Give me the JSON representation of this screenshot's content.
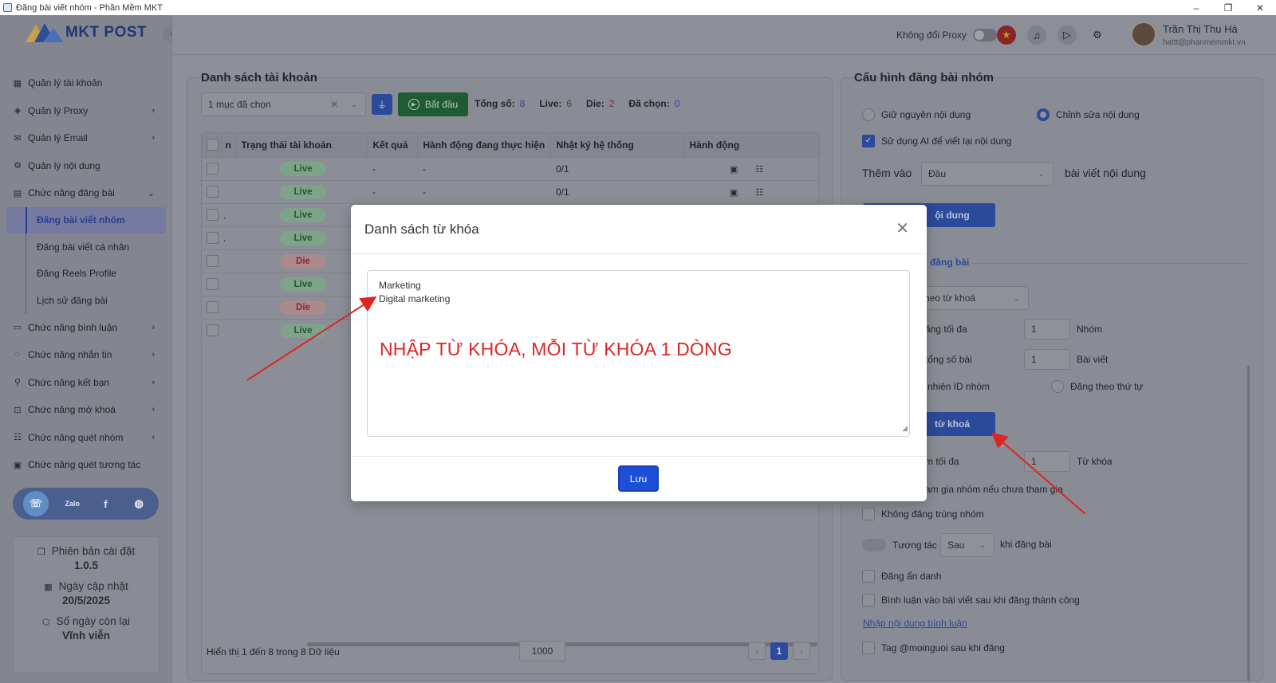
{
  "window": {
    "title": "Đăng bài viết nhóm - Phần Mềm MKT",
    "min": "–",
    "restore": "❐",
    "close": "✕"
  },
  "logo": {
    "text": "MKT POST"
  },
  "sidebar": {
    "items": [
      {
        "label": "Quản lý tài khoản",
        "icon": "grid-icon",
        "chev": ""
      },
      {
        "label": "Quản lý Proxy",
        "icon": "layers-icon",
        "chev": "›"
      },
      {
        "label": "Quản lý Email",
        "icon": "mail-icon",
        "chev": "›"
      },
      {
        "label": "Quản lý nội dung",
        "icon": "content-icon",
        "chev": ""
      },
      {
        "label": "Chức năng đăng bài",
        "icon": "post-icon",
        "chev": "⌄"
      }
    ],
    "subitems": [
      "Đăng bài viết nhóm",
      "Đăng bài viết cá nhân",
      "Đăng Reels Profile",
      "Lịch sử đăng bài"
    ],
    "items2": [
      {
        "label": "Chức năng bình luận",
        "chev": "›"
      },
      {
        "label": "Chức năng nhắn tin",
        "chev": "›"
      },
      {
        "label": "Chức năng kết bạn",
        "chev": "›"
      },
      {
        "label": "Chức năng mở khoá",
        "chev": "›"
      },
      {
        "label": "Chức năng quét nhóm",
        "chev": "›"
      },
      {
        "label": "Chức năng quét tương tác",
        "chev": ""
      }
    ],
    "info": [
      {
        "label": "Phiên bản cài đặt",
        "value": "1.0.5"
      },
      {
        "label": "Ngày cập nhật",
        "value": "20/5/2025"
      },
      {
        "label": "Số ngày còn lại",
        "value": "Vĩnh viễn"
      }
    ]
  },
  "topbar": {
    "proxy_label": "Không đổi Proxy",
    "user_name": "Trần Thị Thu Hà",
    "user_email": "hattt@phanmemmkt.vn"
  },
  "accounts": {
    "title": "Danh sách tài khoản",
    "select_value": "1 mục đã chọn",
    "start_label": "Bắt đầu",
    "stats": {
      "total_label": "Tổng số:",
      "total": "8",
      "live_label": "Live:",
      "live": "6",
      "die_label": "Die:",
      "die": "2",
      "selected_label": "Đã chọn:",
      "selected": "0"
    },
    "columns": [
      "n",
      "Trạng thái tài khoản",
      "Kết quả",
      "Hành động đang thực hiện",
      "Nhật ký hệ thống",
      "Hành động"
    ],
    "rows": [
      {
        "status": "Live",
        "result": "-",
        "action": "-",
        "log": "0/1",
        "n": ""
      },
      {
        "status": "Live",
        "result": "-",
        "action": "-",
        "log": "0/1",
        "n": ""
      },
      {
        "status": "Live",
        "result": "",
        "action": "",
        "log": "",
        "n": "."
      },
      {
        "status": "Live",
        "result": "",
        "action": "",
        "log": "",
        "n": "."
      },
      {
        "status": "Die",
        "result": "",
        "action": "",
        "log": "",
        "n": ""
      },
      {
        "status": "Live",
        "result": "",
        "action": "",
        "log": "",
        "n": ""
      },
      {
        "status": "Die",
        "result": "",
        "action": "",
        "log": "",
        "n": ""
      },
      {
        "status": "Live",
        "result": "",
        "action": "",
        "log": "",
        "n": ""
      }
    ],
    "footer": {
      "info": "Hiển thị 1 đến 8 trong 8 Dữ liệu",
      "page_size": "1000",
      "page": "1",
      "prev": "‹",
      "next": "›"
    }
  },
  "config": {
    "title": "Cấu hình đăng bài nhóm",
    "keep_content": "Giữ nguyên nội dung",
    "edit_content": "Chỉnh sửa nội dung",
    "use_ai": "Sử dụng AI để viết lại nội dung",
    "add_to_label": "Thêm vào",
    "add_to_value": "Đầu",
    "add_to_suffix": "bài viết nội dung",
    "content_btn": "ội dung",
    "section_label": "đăng bài",
    "mode_value": "heo từ khoá",
    "max_groups_label": "ăng tối đa",
    "max_groups": "1",
    "max_groups_unit": "Nhóm",
    "total_posts_label": "tổng số bài",
    "total_posts": "1",
    "total_posts_unit": "Bài viết",
    "random_id_label": "nhiên ID nhóm",
    "order_label": "Đăng theo thứ tự",
    "keyword_btn": "từ khoá",
    "max_keywords_label": "m tối đa",
    "max_keywords": "1",
    "max_keywords_unit": "Từ khóa",
    "join_label": "am gia nhóm nếu chưa tham gia",
    "no_dup": "Không đăng trùng nhóm",
    "interact_label": "Tương tác",
    "interact_value": "Sau",
    "interact_suffix": "khi đăng bài",
    "anonymous": "Đăng ẩn danh",
    "comment_after": "Bình luận vào bài viết sau khi đăng thành công",
    "comment_link": "Nhập nội dung bình luận",
    "tag_all": "Tag @moinguoi sau khi đăng"
  },
  "modal": {
    "title": "Danh sách từ khóa",
    "keywords": [
      "Marketing",
      "Digital marketing"
    ],
    "annotation": "NHẬP TỪ KHÓA, MỖI TỪ KHÓA 1 DÒNG",
    "save_label": "Lưu"
  },
  "colors": {
    "accent": "#1d4ed8",
    "annotation": "#e02424",
    "live": "#215c2e",
    "die": "#8a2a30"
  }
}
